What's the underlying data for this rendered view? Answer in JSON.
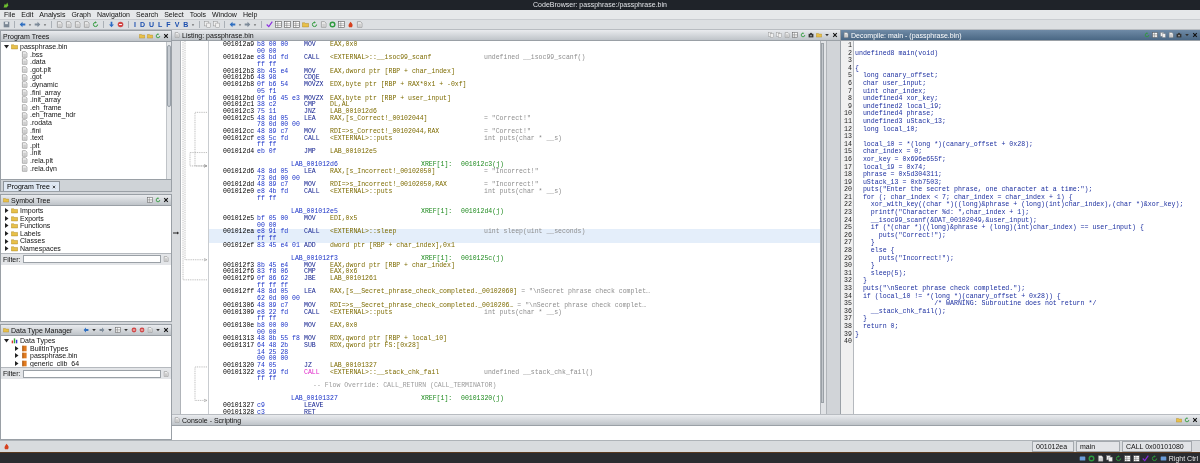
{
  "window": {
    "title": "CodeBrowser: passphrase:/passphrase.bin"
  },
  "menu": [
    "File",
    "Edit",
    "Analysis",
    "Graph",
    "Navigation",
    "Search",
    "Select",
    "Tools",
    "Window",
    "Help"
  ],
  "toolbar": {
    "letter_buttons": [
      "I",
      "D",
      "U",
      "L",
      "F",
      "V",
      "B"
    ]
  },
  "program_trees": {
    "title": "Program Trees",
    "tree": [
      {
        "label": "passphrase.bin",
        "expanded": true,
        "children": [
          {
            "label": ".bss"
          },
          {
            "label": ".data"
          },
          {
            "label": ".got.plt"
          },
          {
            "label": ".got"
          },
          {
            "label": ".dynamic"
          },
          {
            "label": ".fini_array"
          },
          {
            "label": ".init_array"
          },
          {
            "label": ".eh_frame"
          },
          {
            "label": ".eh_frame_hdr"
          },
          {
            "label": ".rodata"
          },
          {
            "label": ".fini"
          },
          {
            "label": ".text"
          },
          {
            "label": ".plt"
          },
          {
            "label": ".init"
          },
          {
            "label": ".rela.plt"
          },
          {
            "label": ".rela.dyn"
          }
        ]
      }
    ],
    "tabs": [
      {
        "label": "Program Tree",
        "selected": true
      }
    ]
  },
  "symbol_tree": {
    "title": "Symbol Tree",
    "tree": [
      {
        "label": "Imports",
        "expanded": false
      },
      {
        "label": "Exports",
        "expanded": false
      },
      {
        "label": "Functions",
        "expanded": false
      },
      {
        "label": "Labels",
        "expanded": false
      },
      {
        "label": "Classes",
        "expanded": false
      },
      {
        "label": "Namespaces",
        "expanded": false
      }
    ],
    "filter": {
      "label": "Filter:"
    }
  },
  "data_type_manager": {
    "title": "Data Type Manager",
    "tree": [
      {
        "label": "Data Types",
        "expanded": true,
        "children": [
          {
            "label": "BuiltInTypes",
            "expanded": false
          },
          {
            "label": "passphrase.bin",
            "expanded": false
          },
          {
            "label": "generic_clib_64",
            "expanded": false
          }
        ]
      }
    ],
    "filter": {
      "label": "Filter:"
    }
  },
  "listing": {
    "title": "Listing:  passphrase.bin",
    "lines": [
      {
        "kind": "instr",
        "address": "001012a9",
        "bytes": "b8 00 00",
        "mnemonic": "MOV",
        "operand": "EAX,0x0",
        "no_return": false,
        "selected": false
      },
      {
        "kind": "cont",
        "bytes": "00 00",
        "selected": false
      },
      {
        "kind": "instr",
        "address": "001012ae",
        "bytes": "e8 bd fd",
        "mnemonic": "CALL",
        "operand": "<EXTERNAL>::__isoc99_scanf",
        "comment": "undefined __isoc99_scanf()",
        "no_return": false,
        "selected": false
      },
      {
        "kind": "cont",
        "bytes": "ff ff",
        "selected": false
      },
      {
        "kind": "instr",
        "address": "001012b3",
        "bytes": "8b 45 e4",
        "mnemonic": "MOV",
        "operand": "EAX,dword ptr [RBP + char_index]",
        "no_return": false,
        "selected": false
      },
      {
        "kind": "instr",
        "address": "001012b6",
        "bytes": "48 98",
        "mnemonic": "CDQE",
        "no_return": false,
        "selected": false
      },
      {
        "kind": "instr",
        "address": "001012b8",
        "bytes": "0f b6 54",
        "mnemonic": "MOVZX",
        "operand": "EDX,byte ptr [RBP + RAX*0x1 + -0xf]",
        "no_return": false,
        "selected": false
      },
      {
        "kind": "cont",
        "bytes": "05 f1",
        "selected": false
      },
      {
        "kind": "instr",
        "address": "001012bd",
        "bytes": "0f b6 45 e3",
        "mnemonic": "MOVZX",
        "operand": "EAX,byte ptr [RBP + user_input]",
        "no_return": false,
        "selected": false
      },
      {
        "kind": "instr",
        "address": "001012c1",
        "bytes": "38 c2",
        "mnemonic": "CMP",
        "operand": "DL,AL",
        "no_return": false,
        "selected": false
      },
      {
        "kind": "instr",
        "address": "001012c3",
        "bytes": "75 11",
        "mnemonic": "JNZ",
        "operand": "LAB_001012d6",
        "no_return": false,
        "selected": false
      },
      {
        "kind": "instr",
        "address": "001012c5",
        "bytes": "48 8d 05",
        "mnemonic": "LEA",
        "operand": "RAX,[s_Correct!_00102044]",
        "comment": "= \"Correct!\"",
        "no_return": false,
        "selected": false
      },
      {
        "kind": "cont",
        "bytes": "78 0d 00 00",
        "selected": false
      },
      {
        "kind": "instr",
        "address": "001012cc",
        "bytes": "48 89 c7",
        "mnemonic": "MOV",
        "operand": "RDI=>s_Correct!_00102044,RAX",
        "comment": "= \"Correct!\"",
        "no_return": false,
        "selected": false
      },
      {
        "kind": "instr",
        "address": "001012cf",
        "bytes": "e8 5c fd",
        "mnemonic": "CALL",
        "operand": "<EXTERNAL>::puts",
        "comment": "int puts(char * __s)",
        "no_return": false,
        "selected": false
      },
      {
        "kind": "cont",
        "bytes": "ff ff",
        "selected": false
      },
      {
        "kind": "instr",
        "address": "001012d4",
        "bytes": "eb 0f",
        "mnemonic": "JMP",
        "operand": "LAB_001012e5",
        "no_return": false,
        "selected": false
      },
      {
        "kind": "blank",
        "selected": false
      },
      {
        "kind": "label",
        "label": "LAB_001012d6",
        "xref_label": "XREF[1]:",
        "xref": "001012c3(j)",
        "selected": false
      },
      {
        "kind": "instr",
        "address": "001012d6",
        "bytes": "48 8d 05",
        "mnemonic": "LEA",
        "operand": "RAX,[s_Incorrect!_00102050]",
        "comment": "= \"Incorrect!\"",
        "no_return": false,
        "selected": false
      },
      {
        "kind": "cont",
        "bytes": "73 0d 00 00",
        "selected": false
      },
      {
        "kind": "instr",
        "address": "001012dd",
        "bytes": "48 89 c7",
        "mnemonic": "MOV",
        "operand": "RDI=>s_Incorrect!_00102050,RAX",
        "comment": "= \"Incorrect!\"",
        "no_return": false,
        "selected": false
      },
      {
        "kind": "instr",
        "address": "001012e0",
        "bytes": "e8 4b fd",
        "mnemonic": "CALL",
        "operand": "<EXTERNAL>::puts",
        "comment": "int puts(char * __s)",
        "no_return": false,
        "selected": false
      },
      {
        "kind": "cont",
        "bytes": "ff ff",
        "selected": false
      },
      {
        "kind": "blank",
        "selected": false
      },
      {
        "kind": "label",
        "label": "LAB_001012e5",
        "xref_label": "XREF[1]:",
        "xref": "001012d4(j)",
        "selected": false
      },
      {
        "kind": "instr",
        "address": "001012e5",
        "bytes": "bf 05 00",
        "mnemonic": "MOV",
        "operand": "EDI,0x5",
        "no_return": false,
        "selected": false
      },
      {
        "kind": "cont",
        "bytes": "00 00",
        "selected": false
      },
      {
        "kind": "instr",
        "address": "001012ea",
        "bytes": "e8 91 fd",
        "mnemonic": "CALL",
        "operand": "<EXTERNAL>::sleep",
        "comment": "uint sleep(uint __seconds)",
        "no_return": false,
        "selected": true
      },
      {
        "kind": "cont",
        "bytes": "ff ff",
        "selected": true
      },
      {
        "kind": "instr",
        "address": "001012ef",
        "bytes": "83 45 e4 01",
        "mnemonic": "ADD",
        "operand": "dword ptr [RBP + char_index],0x1",
        "no_return": false,
        "selected": false
      },
      {
        "kind": "blank",
        "selected": false
      },
      {
        "kind": "label",
        "label": "LAB_001012f3",
        "xref_label": "XREF[1]:",
        "xref": "0010125c(j)",
        "selected": false
      },
      {
        "kind": "instr",
        "address": "001012f3",
        "bytes": "8b 45 e4",
        "mnemonic": "MOV",
        "operand": "EAX,dword ptr [RBP + char_index]",
        "no_return": false,
        "selected": false
      },
      {
        "kind": "instr",
        "address": "001012f6",
        "bytes": "83 f8 06",
        "mnemonic": "CMP",
        "operand": "EAX,0x6",
        "no_return": false,
        "selected": false
      },
      {
        "kind": "instr",
        "address": "001012f9",
        "bytes": "0f 86 62",
        "mnemonic": "JBE",
        "operand": "LAB_00101261",
        "no_return": false,
        "selected": false
      },
      {
        "kind": "cont",
        "bytes": "ff ff ff",
        "selected": false
      },
      {
        "kind": "instr",
        "address": "001012ff",
        "bytes": "48 8d 05",
        "mnemonic": "LEA",
        "operand": "RAX,[s__Secret_phrase_check_completed._00102060]",
        "comment": "= \"\\nSecret phrase check complet…",
        "no_return": false,
        "selected": false
      },
      {
        "kind": "cont",
        "bytes": "62 0d 00 00",
        "selected": false
      },
      {
        "kind": "instr",
        "address": "00101306",
        "bytes": "48 89 c7",
        "mnemonic": "MOV",
        "operand": "RDI=>s__Secret_phrase_check_completed._0010206…",
        "comment": "= \"\\nSecret phrase check complet…",
        "no_return": false,
        "selected": false
      },
      {
        "kind": "instr",
        "address": "00101309",
        "bytes": "e8 22 fd",
        "mnemonic": "CALL",
        "operand": "<EXTERNAL>::puts",
        "comment": "int puts(char * __s)",
        "no_return": false,
        "selected": false
      },
      {
        "kind": "cont",
        "bytes": "ff ff",
        "selected": false
      },
      {
        "kind": "instr",
        "address": "0010130e",
        "bytes": "b8 00 00",
        "mnemonic": "MOV",
        "operand": "EAX,0x0",
        "no_return": false,
        "selected": false
      },
      {
        "kind": "cont",
        "bytes": "00 00",
        "selected": false
      },
      {
        "kind": "instr",
        "address": "00101313",
        "bytes": "48 8b 55 f8",
        "mnemonic": "MOV",
        "operand": "RDX,qword ptr [RBP + local_10]",
        "no_return": false,
        "selected": false
      },
      {
        "kind": "instr",
        "address": "00101317",
        "bytes": "64 48 2b",
        "mnemonic": "SUB",
        "operand": "RDX,qword ptr FS:[0x28]",
        "no_return": false,
        "selected": false
      },
      {
        "kind": "cont",
        "bytes": "14 25 28",
        "selected": false
      },
      {
        "kind": "cont",
        "bytes": "00 00 00",
        "selected": false
      },
      {
        "kind": "instr",
        "address": "00101320",
        "bytes": "74 05",
        "mnemonic": "JZ",
        "operand": "LAB_00101327",
        "no_return": false,
        "selected": false
      },
      {
        "kind": "instr",
        "address": "00101322",
        "bytes": "e8 29 fd",
        "mnemonic": "CALL",
        "operand": "<EXTERNAL>::__stack_chk_fail",
        "comment": "undefined __stack_chk_fail()",
        "no_return": true,
        "selected": false
      },
      {
        "kind": "cont",
        "bytes": "ff ff",
        "selected": false
      },
      {
        "kind": "note",
        "text": "-- Flow Override: CALL_RETURN (CALL_TERMINATOR)",
        "selected": false
      },
      {
        "kind": "blank",
        "selected": false
      },
      {
        "kind": "label",
        "label": "LAB_00101327",
        "xref_label": "XREF[1]:",
        "xref": "00101320(j)",
        "selected": false
      },
      {
        "kind": "instr",
        "address": "00101327",
        "bytes": "c9",
        "mnemonic": "LEAVE",
        "no_return": false,
        "selected": false
      },
      {
        "kind": "instr",
        "address": "00101328",
        "bytes": "c3",
        "mnemonic": "RET",
        "no_return": false,
        "selected": false
      }
    ]
  },
  "decompile": {
    "title": "Decompile: main -  (passphrase.bin)",
    "lines": [
      {
        "n": "1"
      },
      {
        "n": "2",
        "code": "undefined8 main(void)"
      },
      {
        "n": "3"
      },
      {
        "n": "4",
        "code": "{"
      },
      {
        "n": "5",
        "code": "  long canary_offset;"
      },
      {
        "n": "6",
        "code": "  char user_input;"
      },
      {
        "n": "7",
        "code": "  uint char_index;"
      },
      {
        "n": "8",
        "code": "  undefined4 xor_key;"
      },
      {
        "n": "9",
        "code": "  undefined2 local_19;"
      },
      {
        "n": "10",
        "code": "  undefined4 phrase;"
      },
      {
        "n": "11",
        "code": "  undefined3 uStack_13;"
      },
      {
        "n": "12",
        "code": "  long local_10;"
      },
      {
        "n": "13"
      },
      {
        "n": "14",
        "code": "  local_10 = *(long *)(canary_offset + 0x28);"
      },
      {
        "n": "15",
        "code": "  char_index = 0;"
      },
      {
        "n": "16",
        "code": "  xor_key = 0x696e655f;"
      },
      {
        "n": "17",
        "code": "  local_19 = 0x74;"
      },
      {
        "n": "18",
        "code": "  phrase = 0x5d304311;"
      },
      {
        "n": "19",
        "code": "  uStack_13 = 0xb7503;"
      },
      {
        "n": "20",
        "code": "  puts(\"Enter the secret phrase, one character at a time:\");"
      },
      {
        "n": "21",
        "code": "  for (; char_index < 7; char_index = char_index + 1) {"
      },
      {
        "n": "22",
        "code": "    xor_with_key((char *)((long)&phrase + (long)(int)char_index),(char *)&xor_key);"
      },
      {
        "n": "23",
        "code": "    printf(\"Character %d: \",char_index + 1);"
      },
      {
        "n": "24",
        "code": "    __isoc99_scanf(&DAT_00102049,&user_input);"
      },
      {
        "n": "25",
        "code": "    if (*(char *)((long)&phrase + (long)(int)char_index) == user_input) {"
      },
      {
        "n": "26",
        "code": "      puts(\"Correct!\");"
      },
      {
        "n": "27",
        "code": "    }"
      },
      {
        "n": "28",
        "code": "    else {"
      },
      {
        "n": "29",
        "code": "      puts(\"Incorrect!\");"
      },
      {
        "n": "30",
        "code": "    }"
      },
      {
        "n": "31",
        "code": "    sleep(5);"
      },
      {
        "n": "32",
        "code": "  }"
      },
      {
        "n": "33",
        "code": "  puts(\"\\nSecret phrase check completed.\");"
      },
      {
        "n": "34",
        "code": "  if (local_10 != *(long *)(canary_offset + 0x28)) {"
      },
      {
        "n": "35",
        "code": "                    /* WARNING: Subroutine does not return */"
      },
      {
        "n": "36",
        "code": "    __stack_chk_fail();"
      },
      {
        "n": "37",
        "code": "  }"
      },
      {
        "n": "38",
        "code": "  return 0;"
      },
      {
        "n": "39",
        "code": "}"
      },
      {
        "n": "40"
      }
    ]
  },
  "console": {
    "title": "Console - Scripting"
  },
  "status_bar": {
    "address": "001012ea",
    "function": "main",
    "instruction": "CALL 0x00101080"
  },
  "taskbar": {
    "keyboard_hint": "Right Ctrl"
  }
}
